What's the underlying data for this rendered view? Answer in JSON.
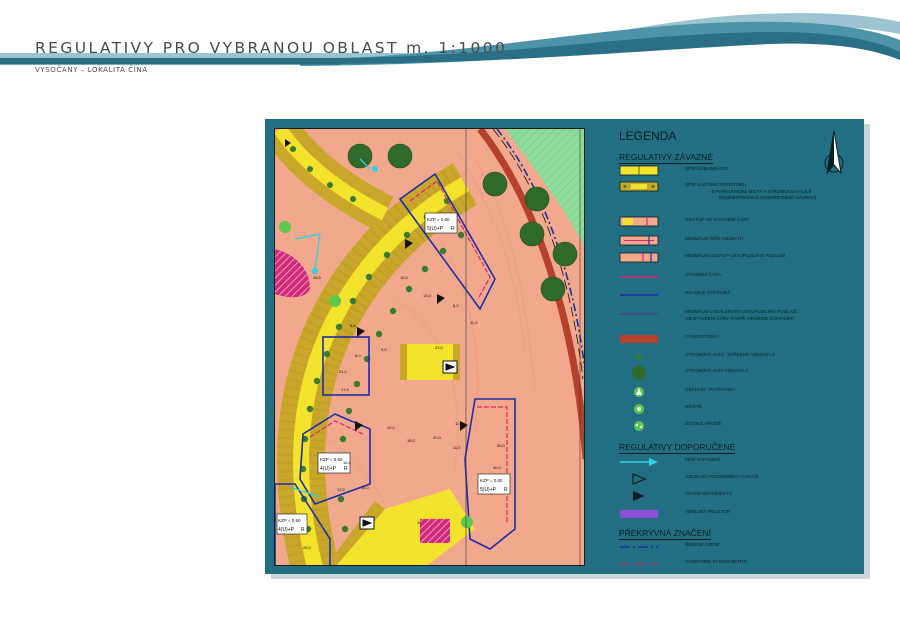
{
  "header": {
    "title": "REGULATIVY PRO VYBRANOU OBLAST m. 1:1000",
    "subtitle": "VYSOČANY – LOKALITA ČÍNA"
  },
  "legend": {
    "title": "LEGENDA",
    "sections": [
      {
        "title": "REGULATIVY ZÁVAZNÉ",
        "items": [
          {
            "symbol": "roadway-width",
            "label": "ŠÍŘE KOMUNIKACE"
          },
          {
            "symbol": "street-space-width",
            "label": "ŠÍŘE ULIČNÍHO PROSTORU",
            "label2": "- S PARKOVACÍMI MÍSTY A STROMOVOU ALEJÍ",
            "label3": "(ROZMÍSTĚNÍ DLE KONKRÉTNÍHO NÁVRHU)"
          },
          {
            "symbol": "building-line-setback",
            "label": "ODSTUP OD STAVEBNÍ ČÁRY"
          },
          {
            "symbol": "min-building-width",
            "label": "MINIMÁLNÍ ŠÍŘE OBJEKTU"
          },
          {
            "symbol": "min-recessed-floor-setback",
            "label": "MINIMÁLNÍ ODSTUP USTUPUJÍCÍHO PODLAŽÍ"
          },
          {
            "symbol": "building-line",
            "label": "STAVEBNÍ ČÁRA"
          },
          {
            "symbol": "development-boundary",
            "label": "HRANICE ZÁSTAVBY"
          },
          {
            "symbol": "min-recessed-floor-distance",
            "label": "MINIMÁLNÍ VZDÁLENOST USTUPUJÍCÍHO PODLAŽÍ",
            "label2": "OD STAVEBNÍ ČÁRY (POPŘ. HRANICE ZÁSTAVBY)"
          },
          {
            "symbol": "cycle-path",
            "label": "CYKLOSTEZKY"
          },
          {
            "symbol": "tree-alley-medium",
            "label": "STROMOVÁ ALEJ - STŘEDNĚ VZROSTLÁ"
          },
          {
            "symbol": "tree-alley-large",
            "label": "STROMOVÁ ALEJ VZROSTLÁ"
          },
          {
            "symbol": "shop-groceries",
            "label": "OBCHOD - POTRAVINY"
          },
          {
            "symbol": "sports-ground",
            "label": "HŘIŠTĚ"
          },
          {
            "symbol": "playground",
            "label": "DĚTSKÉ HŘIŠTĚ"
          }
        ]
      },
      {
        "title": "REGULATIVY DOPORUČENÉ",
        "items": [
          {
            "symbol": "pedestrian-link",
            "label": "PĚŠÍ NAPOJENÍ"
          },
          {
            "symbol": "garage-entrance",
            "label": "VJEZD DO PODZEMNÍCH GARÁŽÍ"
          },
          {
            "symbol": "building-entrance",
            "label": "VCHOD DO OBJEKTU"
          },
          {
            "symbol": "public-space",
            "label": "VEŘEJNÝ PROSTOR"
          }
        ]
      },
      {
        "title": "PŘEKRYVNÁ ZNAČENÍ",
        "items": [
          {
            "symbol": "solved-area",
            "label": "ŘEŠENÉ ÚZEMÍ"
          },
          {
            "symbol": "metro-protection-zone",
            "label": "OCHRANNÉ PÁSMO METRA"
          }
        ]
      }
    ]
  },
  "map": {
    "blocks": [
      {
        "kzp": "KZP = 0,60",
        "floors": "5(U)+P",
        "suffix": "R"
      },
      {
        "kzp": "KZP = 0,50",
        "floors": "4(U)+P",
        "suffix": "R"
      },
      {
        "kzp": "KZP = 0,60",
        "floors": "5(U)+P",
        "suffix": "R"
      },
      {
        "kzp": "KZP = 0,50",
        "floors": "4(U)+P",
        "suffix": "R"
      }
    ],
    "dims": [
      "16,0",
      "13,0",
      "8,5",
      "11,5",
      "6,5",
      "9,0",
      "6,0",
      "10,0",
      "21,0",
      "18,0",
      "17,5",
      "20,0",
      "16,0",
      "10,0",
      "28,5",
      "26,0",
      "11,5",
      "30,0",
      "40,0",
      "11,5",
      "13,5",
      "16,0",
      "23,0"
    ]
  },
  "colors": {
    "panel": "#226f83",
    "background_land": "#f1a88c",
    "road": "#f3e32c",
    "street_strip": "#c9a72a",
    "tree": "#3b7a32",
    "building_line": "#e0256c",
    "boundary": "#1b2fa8",
    "cycle_path": "#b5402c",
    "green_area": "#8fdb9a",
    "public_space": "#8a4fd6"
  }
}
